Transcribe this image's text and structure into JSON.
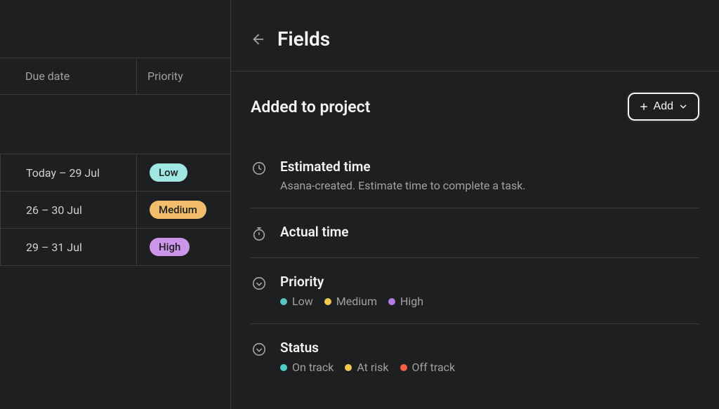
{
  "left": {
    "headers": {
      "due": "Due date",
      "priority": "Priority"
    },
    "rows": [
      {
        "due": "Today – 29 Jul",
        "priority": {
          "label": "Low",
          "class": "pill-low"
        }
      },
      {
        "due": "26 – 30 Jul",
        "priority": {
          "label": "Medium",
          "class": "pill-medium"
        }
      },
      {
        "due": "29 – 31 Jul",
        "priority": {
          "label": "High",
          "class": "pill-high"
        }
      }
    ]
  },
  "panel": {
    "title": "Fields",
    "section_title": "Added to project",
    "add_label": "Add",
    "fields": [
      {
        "icon": "clock",
        "name": "Estimated time",
        "desc": "Asana-created. Estimate time to complete a task."
      },
      {
        "icon": "stopwatch",
        "name": "Actual time"
      },
      {
        "icon": "dropdown",
        "name": "Priority",
        "options": [
          {
            "label": "Low",
            "dot": "dot-teal"
          },
          {
            "label": "Medium",
            "dot": "dot-yellow"
          },
          {
            "label": "High",
            "dot": "dot-purple"
          }
        ]
      },
      {
        "icon": "dropdown",
        "name": "Status",
        "options": [
          {
            "label": "On track",
            "dot": "dot-green"
          },
          {
            "label": "At risk",
            "dot": "dot-yellow"
          },
          {
            "label": "Off track",
            "dot": "dot-orange"
          }
        ]
      }
    ]
  }
}
